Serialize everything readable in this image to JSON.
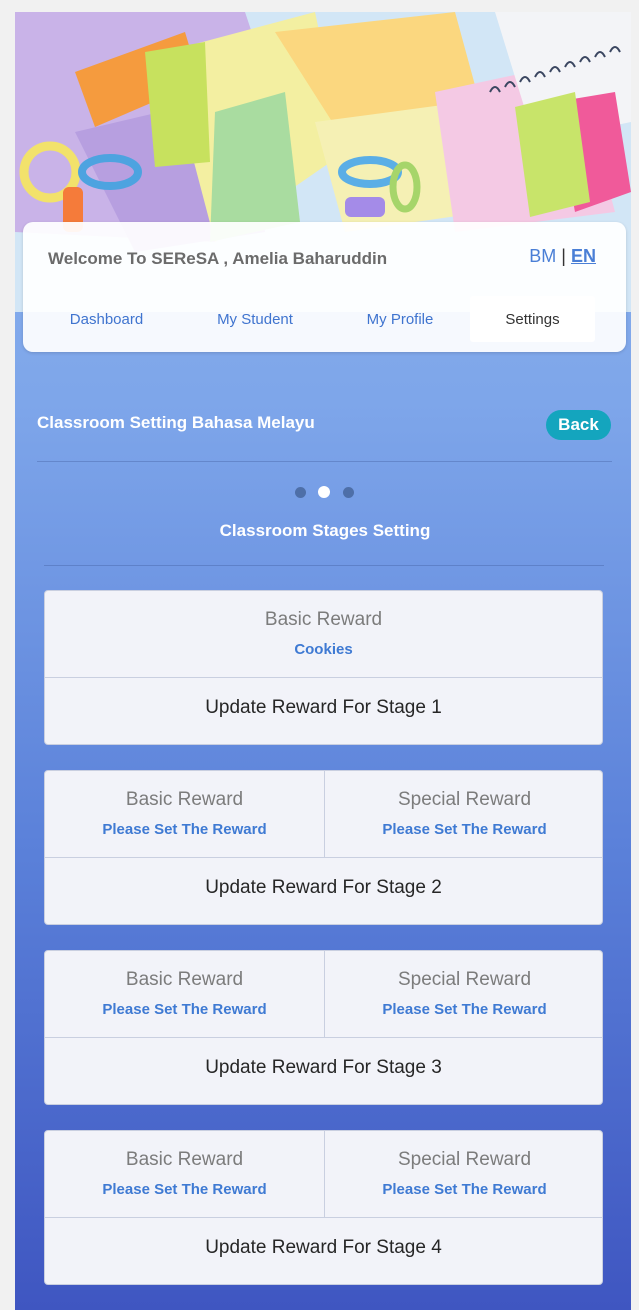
{
  "header": {
    "welcome": "Welcome To SEReSA , Amelia Baharuddin",
    "lang_bm": "BM",
    "lang_sep": "|",
    "lang_en": "EN"
  },
  "nav": {
    "items": [
      "Dashboard",
      "My Student",
      "My Profile",
      "Settings"
    ],
    "active": "Settings"
  },
  "page": {
    "title": "Classroom Setting Bahasa Melayu",
    "back_label": "Back",
    "carousel_active_index": 2,
    "carousel_total": 3,
    "section_title": "Classroom Stages Setting"
  },
  "stages": [
    {
      "basic_label": "Basic Reward",
      "basic_value": "Cookies",
      "update_label": "Update Reward For Stage 1"
    },
    {
      "basic_label": "Basic Reward",
      "basic_value": "Please Set The Reward",
      "special_label": "Special Reward",
      "special_value": "Please Set The Reward",
      "update_label": "Update Reward For Stage 2"
    },
    {
      "basic_label": "Basic Reward",
      "basic_value": "Please Set The Reward",
      "special_label": "Special Reward",
      "special_value": "Please Set The Reward",
      "update_label": "Update Reward For Stage 3"
    },
    {
      "basic_label": "Basic Reward",
      "basic_value": "Please Set The Reward",
      "special_label": "Special Reward",
      "special_value": "Please Set The Reward",
      "update_label": "Update Reward For Stage 4"
    }
  ],
  "colors": {
    "accent": "#3f7ad3",
    "back_button": "#14a5be",
    "background_top": "#8db4ef",
    "background_bottom": "#3f56c1"
  }
}
